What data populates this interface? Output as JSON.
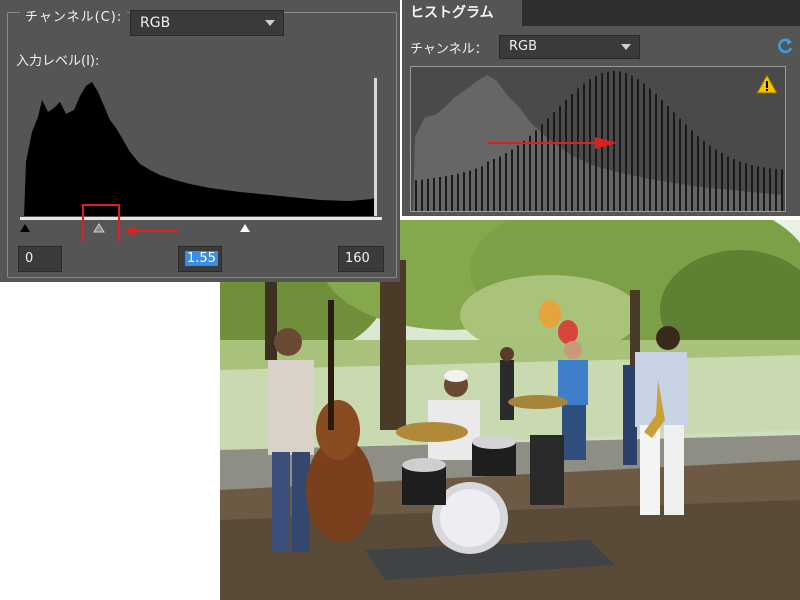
{
  "levels": {
    "channel_label": "チャンネル(C):",
    "channel_value": "RGB",
    "input_levels_label": "入力レベル(I):",
    "black_input": "0",
    "gamma_input": "1.55",
    "white_input": "160"
  },
  "histogram": {
    "tab_title": "ヒストグラム",
    "channel_label": "チャンネル：",
    "channel_value": "RGB"
  },
  "colors": {
    "panel": "#555555",
    "annotation_red": "#e02020",
    "highlight": "#3b8fe0",
    "warning": "#f5c400",
    "refresh": "#3aa0e8"
  },
  "icons": [
    "black-point-slider-icon",
    "gray-point-slider-icon",
    "white-point-slider-icon",
    "refresh-icon",
    "warning-icon"
  ]
}
